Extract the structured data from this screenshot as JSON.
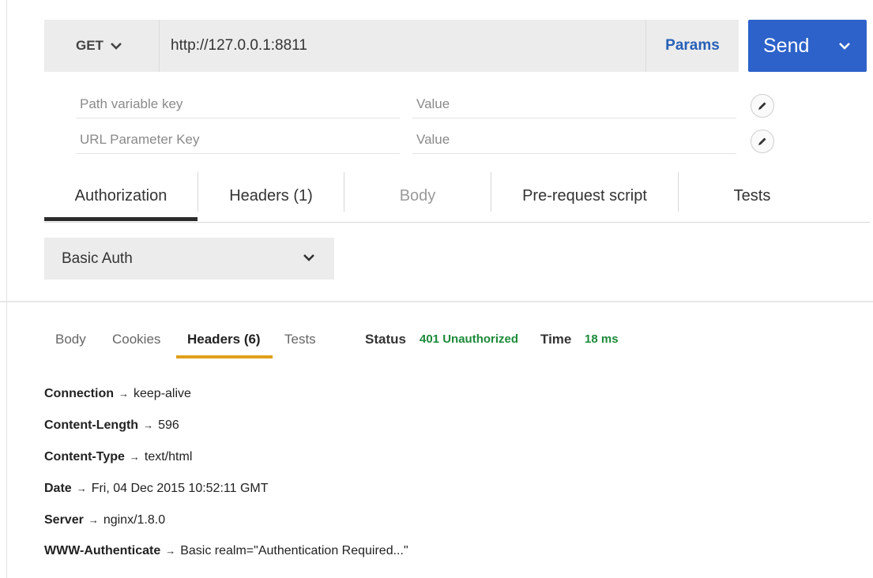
{
  "request": {
    "method": "GET",
    "url": "http://127.0.0.1:8811",
    "params_label": "Params",
    "send_label": "Send",
    "param_rows": [
      {
        "key_placeholder": "Path variable key",
        "value_placeholder": "Value"
      },
      {
        "key_placeholder": "URL Parameter Key",
        "value_placeholder": "Value"
      }
    ],
    "tabs": [
      "Authorization",
      "Headers (1)",
      "Body",
      "Pre-request script",
      "Tests"
    ],
    "active_tab": "Authorization",
    "auth_type": "Basic Auth"
  },
  "response": {
    "tabs": [
      "Body",
      "Cookies",
      "Headers (6)",
      "Tests"
    ],
    "active_tab": "Headers (6)",
    "status_label": "Status",
    "status_value": "401 Unauthorized",
    "time_label": "Time",
    "time_value": "18 ms",
    "headers": [
      {
        "key": "Connection",
        "value": "keep-alive"
      },
      {
        "key": "Content-Length",
        "value": "596"
      },
      {
        "key": "Content-Type",
        "value": "text/html"
      },
      {
        "key": "Date",
        "value": "Fri, 04 Dec 2015 10:52:11 GMT"
      },
      {
        "key": "Server",
        "value": "nginx/1.8.0"
      },
      {
        "key": "WWW-Authenticate",
        "value": "Basic realm=\"Authentication Required...\""
      }
    ],
    "arrow_glyph": "→"
  },
  "colors": {
    "accent_blue": "#2c62c9",
    "params_blue": "#2560b8",
    "status_green": "#1c8a3a",
    "tab_underline_orange": "#e0a01c",
    "field_gray": "#ececec"
  }
}
